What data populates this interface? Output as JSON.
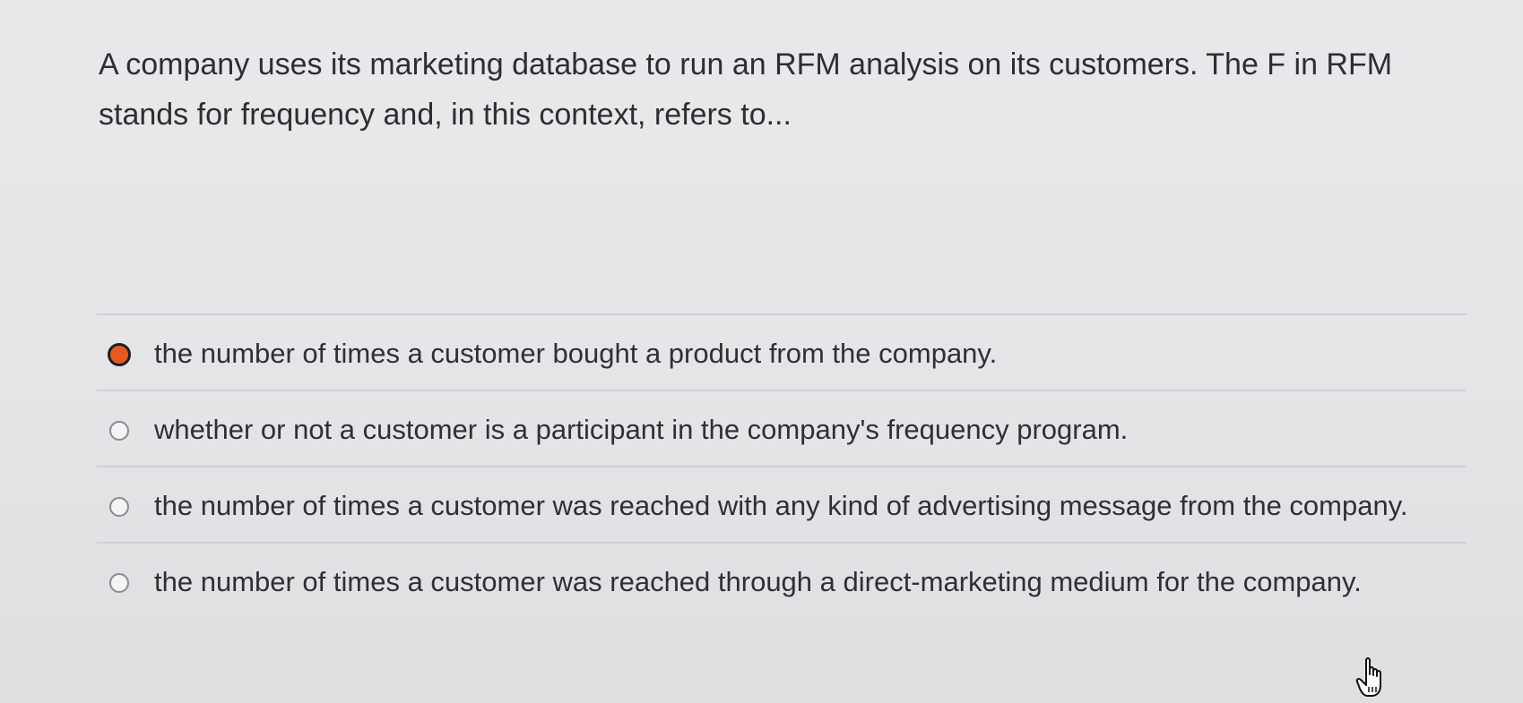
{
  "question": {
    "text": "A company uses its marketing database to run an RFM analysis on its customers. The F in RFM stands for frequency and, in this context, refers to..."
  },
  "options": [
    {
      "label": "the number of times a customer bought a product from the company.",
      "selected": true
    },
    {
      "label": "whether or not a customer is a participant in the company's frequency program.",
      "selected": false
    },
    {
      "label": "the number of times a customer was reached with any kind of advertising message from the company.",
      "selected": false
    },
    {
      "label": "the number of times a customer was reached through a direct-marketing medium for the company.",
      "selected": false
    }
  ],
  "colors": {
    "selected_radio_fill": "#e8591e",
    "text": "#2f2f35",
    "divider": "#cfd0d3"
  },
  "icons": {
    "cursor": "hand-pointer-icon"
  }
}
